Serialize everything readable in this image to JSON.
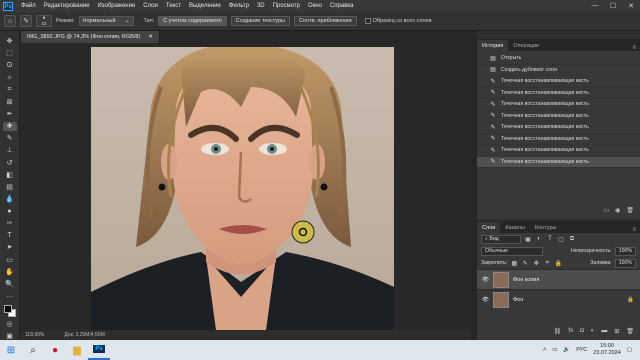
{
  "app": {
    "logo": "Ps"
  },
  "menu": [
    "Файл",
    "Редактирование",
    "Изображение",
    "Слои",
    "Текст",
    "Выделение",
    "Фильтр",
    "3D",
    "Просмотр",
    "Окно",
    "Справка"
  ],
  "window_controls": {
    "minimize": "—",
    "maximize": "☐",
    "close": "✕"
  },
  "options": {
    "brush_size": "15",
    "mode_label": "Режим:",
    "mode_value": "Нормальный",
    "type_label": "Тип:",
    "type_content_aware": "С учетом содержимого",
    "type_texture": "Создание текстуры",
    "type_proximity": "Соотв. приближения",
    "sample_all": "Образец со всех слоев"
  },
  "document": {
    "tab_title": "IMG_3892.JPG @ 74,3% (Фон копия, RGB/8)",
    "zoom": "118,99%",
    "doc_size": "Док: 2,25M/4,50M"
  },
  "history_panel": {
    "tabs": [
      "История",
      "Операции"
    ],
    "items": [
      "Открыть",
      "Создать дубликат слоя",
      "Точечная восстанавливающая кисть",
      "Точечная восстанавливающая кисть",
      "Точечная восстанавливающая кисть",
      "Точечная восстанавливающая кисть",
      "Точечная восстанавливающая кисть",
      "Точечная восстанавливающая кисть",
      "Точечная восстанавливающая кисть",
      "Точечная восстанавливающая кисть"
    ]
  },
  "layers_panel": {
    "tabs": [
      "Слои",
      "Каналы",
      "Контуры"
    ],
    "filter_kind": "Вид",
    "blend_mode": "Обычные",
    "opacity_label": "Непрозрачность:",
    "opacity_value": "100%",
    "lock_label": "Закрепить:",
    "fill_label": "Заливка:",
    "fill_value": "100%",
    "layers": [
      {
        "name": "Фон копия",
        "selected": true
      },
      {
        "name": "Фон",
        "selected": false
      }
    ],
    "footer_fx": "fx"
  },
  "taskbar": {
    "lang": "РУС",
    "time": "15:00",
    "date": "23.07.2024"
  },
  "colors": {
    "accent": "#31a8ff",
    "panel": "#383838",
    "taskbar": "#dfe6ee"
  }
}
